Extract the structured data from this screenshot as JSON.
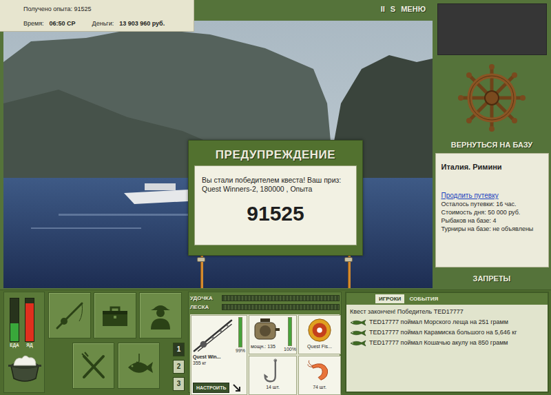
{
  "header": {
    "experience": "Получено опыта: 91525",
    "time_label": "Время:",
    "time": "06:50 СР",
    "money_label": "Деньги:",
    "money": "13 903 960 руб."
  },
  "toolbar": [
    "II",
    "S",
    "МЕНЮ"
  ],
  "dialog": {
    "title": "ПРЕДУПРЕЖДЕНИЕ",
    "message": "Вы стали победителем квеста! Ваш приз: Quest Winners-2, 180000 , Опыта",
    "value": "91525"
  },
  "base": {
    "return_button": "ВЕРНУТЬСЯ НА БАЗУ",
    "location": "Италия. Римини",
    "extend_link": "Продлить путевку",
    "details": [
      "Осталось путевки: 16 час.",
      "Стоимость дня: 50 000 руб.",
      "Рыбаков на базе: 4",
      "Турниры на базе: не объявлены"
    ],
    "bans_button": "ЗАПРЕТЫ"
  },
  "meters": [
    {
      "label": "ЕДА",
      "level": 0.42,
      "color": "#39a83a"
    },
    {
      "label": "ЯД",
      "level": 0.88,
      "color": "#e0301e"
    }
  ],
  "pages": [
    {
      "label": "1",
      "selected": true
    },
    {
      "label": "2",
      "selected": false
    },
    {
      "label": "3",
      "selected": false
    }
  ],
  "gauges": [
    {
      "label": "УДОЧКА",
      "level": 0
    },
    {
      "label": "ЛЕСКА",
      "level": 0
    }
  ],
  "tackle": {
    "rod": {
      "name": "Quest Win...",
      "load": "355 кг",
      "condition": "99%",
      "level": 0.99,
      "button": "НАСТРОИТЬ"
    },
    "reel": {
      "power": "мощн.: 135",
      "condition": "100%",
      "level": 1
    },
    "line": {
      "name": "Quest Fis..."
    },
    "hook": {
      "count": "14 шт."
    },
    "bait": {
      "count": "74 шт."
    }
  },
  "log": {
    "tabs": [
      {
        "label": "ИГРОКИ",
        "selected": true
      },
      {
        "label": "СОБЫТИЯ",
        "selected": false
      }
    ],
    "entries": [
      {
        "text": "Квест закончен! Победитель TED17777",
        "kind": "notice"
      },
      {
        "text": "TED17777 поймал Морского леща на 251 грамм",
        "kind": "catch"
      },
      {
        "text": "TED17777 поймал Карамиска большого на 5,646 кг",
        "kind": "catch"
      },
      {
        "text": "TED17777 поймал Кошачью акулу на 850 грамм",
        "kind": "catch"
      }
    ]
  }
}
